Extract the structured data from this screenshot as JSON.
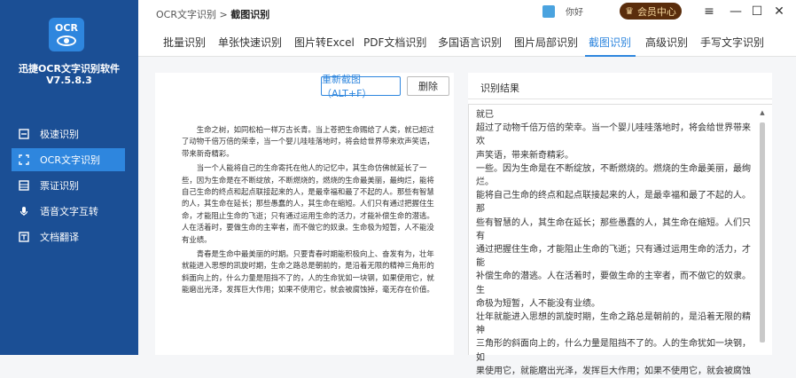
{
  "app": {
    "logo_text": "OCR",
    "name": "迅捷OCR文字识别软件",
    "version": "V7.5.8.3"
  },
  "sidebar": {
    "items": [
      {
        "label": "极速识别",
        "icon": "camera-icon"
      },
      {
        "label": "OCR文字识别",
        "icon": "ocr-icon"
      },
      {
        "label": "票证识别",
        "icon": "grid-icon"
      },
      {
        "label": "语音文字互转",
        "icon": "microphone-icon"
      },
      {
        "label": "文档翻译",
        "icon": "translate-icon"
      }
    ],
    "active_index": 1
  },
  "topbar": {
    "breadcrumb_root": "OCR文字识别",
    "breadcrumb_sep": ">",
    "breadcrumb_current": "截图识别",
    "user_name": "你好",
    "vip_label": "会员中心",
    "vip_icon": "crown-icon",
    "menu_icon": "≡",
    "minimize_icon": "—",
    "maximize_icon": "☐",
    "close_icon": "✕"
  },
  "tabs": [
    "批量识别",
    "单张快速识别",
    "图片转Excel",
    "PDF文档识别",
    "多国语言识别",
    "图片局部识别",
    "截图识别",
    "高级识别",
    "手写文字识别"
  ],
  "active_tab": 6,
  "toolbar": {
    "recapture_label": "重新截图（ALT+F）",
    "delete_label": "删除"
  },
  "document": {
    "paragraphs": [
      "生命之树，如同松柏一样万古长青。当上苍把生命赐给了人类，就已超过了动物千倍万倍的荣幸，当一个婴儿哇哇落地时，将会给世界带来欢声笑语，带来新奇精彩。",
      "当一个人能将自己的生命寄托在他人的记忆中，其生命仿佛就延长了一些，因为生命是在不断绽放，不断燃烧的，燃烧的生命最美丽，最绚烂，能将自己生命的终点和起点联接起来的人，是最幸福和最了不起的人。那些有智慧的人，其生命在延长；那些愚蠢的人，其生命在缩短。人们只有通过把握住生命，才能阻止生命的飞逝；只有通过运用生命的活力，才能补偿生命的潜逃。人在活着时，要做生命的主宰者，而不做它的奴隶。生命极为短暂，人不能没有业绩。",
      "青春是生命中最美丽的时期。只要青春时期能积极向上、奋发有为，壮年就能进入思想的凯旋时期，生命之路总是朝前的，是沿着无限的精神三角形的斜面向上的，什么力量是阻挡不了的，人的生命犹如一块钢，如果使用它，就能磨出光泽，发挥巨大作用；如果不使用它，就会被腐蚀掉，毫无存在价值。"
    ]
  },
  "result": {
    "title": "识别结果",
    "lines": [
      "就已",
      "超过了动物千倍万倍的荣幸。当一个婴儿哇哇落地时，将会给世界带来",
      "欢",
      "声笑语，带来新奇精彩。",
      "一些。因为生命是在不断绽放，不断燃烧的。燃烧的生命最美丽，最绚",
      "烂。",
      "能将自己生命的终点和起点联接起来的人，是最幸福和最了不起的人。",
      "那",
      "些有智慧的人，其生命在延长；那些愚蠢的人，其生命在缩短。人们只",
      "有",
      "通过把握住生命，才能阻止生命的飞逝；只有通过运用生命的活力，才",
      "能",
      "补偿生命的潜逃。人在活着时，要做生命的主宰者，而不做它的奴隶。",
      "生",
      "命极为短暂，人不能没有业绩。",
      "壮年就能进入思想的凯旋时期，生命之路总是朝前的，是沿着无限的精",
      "神",
      "三角形的斜面向上的，什么力量是阻挡不了的。人的生命犹如一块钢，",
      "如",
      "果使用它，就能磨出光泽，发挥巨大作用；如果不使用它，就会被腐蚀"
    ]
  },
  "colors": {
    "sidebar_bg": "#1b4f95",
    "accent": "#2e86de",
    "vip_bg": "#5a2d0c"
  }
}
